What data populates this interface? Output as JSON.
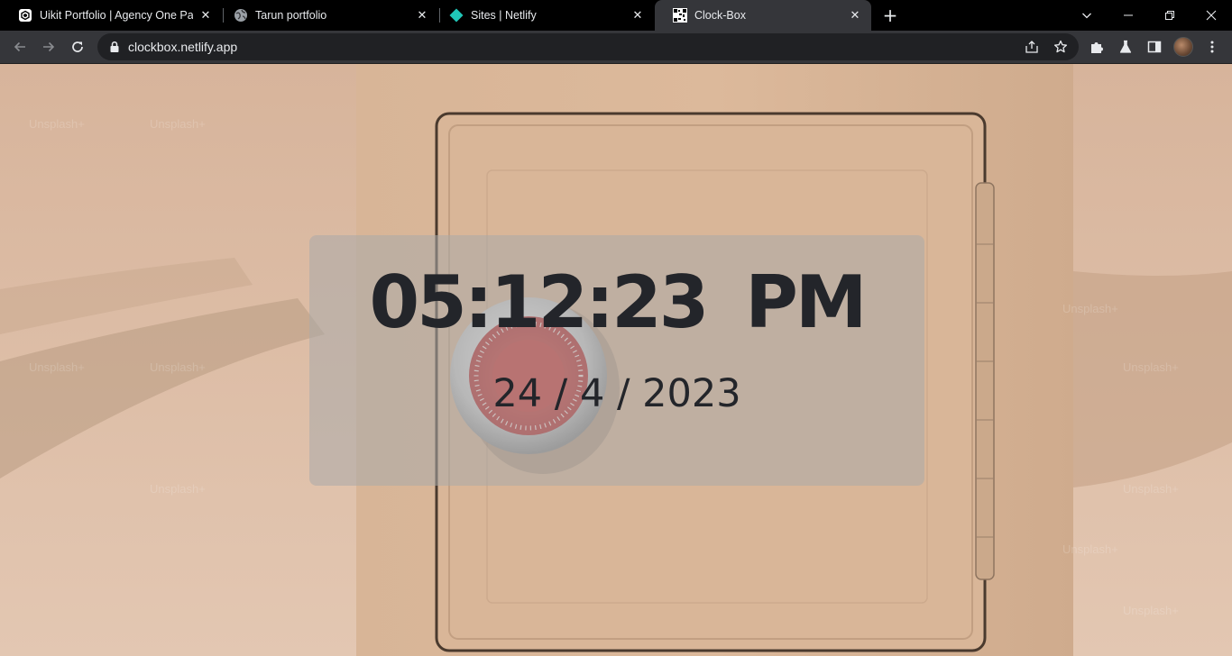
{
  "browser": {
    "tabs": [
      {
        "title": "Uikit Portfolio | Agency One Page",
        "icon": "uikit-favicon-icon",
        "active": false
      },
      {
        "title": "Tarun portfolio",
        "icon": "globe-icon",
        "active": false
      },
      {
        "title": "Sites | Netlify",
        "icon": "netlify-favicon-icon",
        "active": false
      },
      {
        "title": "Clock-Box",
        "icon": "clockbox-favicon-icon",
        "active": true
      }
    ],
    "address_bar": {
      "url": "clockbox.netlify.app"
    }
  },
  "page": {
    "background": {
      "watermark": "Unsplash+"
    },
    "clock": {
      "time": "05:12:23  PM",
      "date": "24 / 4 / 2023"
    }
  },
  "colors": {
    "tab_strip": "#000000",
    "toolbar": "#35363a",
    "omnibox": "#202124",
    "clock_text": "#23252a",
    "netlify": "#20c6b7"
  }
}
